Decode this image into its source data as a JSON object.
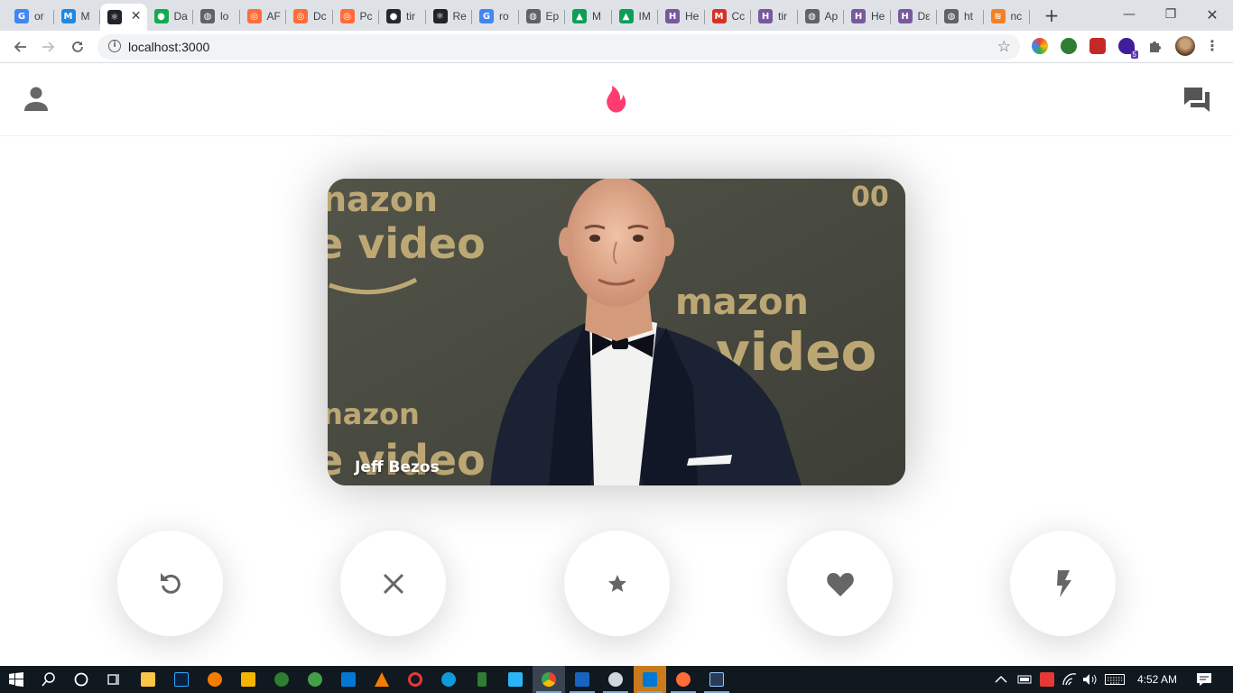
{
  "browser": {
    "tabs": [
      {
        "title": "or",
        "icon": "google-icon",
        "color": "#4285f4",
        "glyph": "G"
      },
      {
        "title": "M",
        "icon": "mui-icon",
        "color": "#1e88e5",
        "glyph": "M"
      },
      {
        "title": "",
        "icon": "react-icon",
        "color": "#20232a",
        "glyph": "⚛",
        "active": true
      },
      {
        "title": "Da",
        "icon": "mongodb-icon",
        "color": "#13aa52",
        "glyph": "●"
      },
      {
        "title": "lo",
        "icon": "globe-icon",
        "color": "#5f6368",
        "glyph": "◍"
      },
      {
        "title": "AF",
        "icon": "postman-icon",
        "color": "#ff6c37",
        "glyph": "◎"
      },
      {
        "title": "Dc",
        "icon": "postman-icon",
        "color": "#ff6c37",
        "glyph": "◎"
      },
      {
        "title": "Pc",
        "icon": "postman-icon",
        "color": "#ff6c37",
        "glyph": "◎"
      },
      {
        "title": "tir",
        "icon": "github-icon",
        "color": "#24292e",
        "glyph": "●"
      },
      {
        "title": "Re",
        "icon": "react-icon",
        "color": "#20232a",
        "glyph": "⚛"
      },
      {
        "title": "ro",
        "icon": "google-icon",
        "color": "#4285f4",
        "glyph": "G"
      },
      {
        "title": "Ep",
        "icon": "globe-icon",
        "color": "#5f6368",
        "glyph": "◍"
      },
      {
        "title": "M",
        "icon": "drive-icon",
        "color": "#0f9d58",
        "glyph": "▲"
      },
      {
        "title": "IM",
        "icon": "drive-icon",
        "color": "#0f9d58",
        "glyph": "▲"
      },
      {
        "title": "He",
        "icon": "heroku-icon",
        "color": "#79589f",
        "glyph": "H"
      },
      {
        "title": "Cc",
        "icon": "gmail-icon",
        "color": "#d93025",
        "glyph": "M"
      },
      {
        "title": "tir",
        "icon": "heroku-icon",
        "color": "#79589f",
        "glyph": "H"
      },
      {
        "title": "Ap",
        "icon": "globe-icon",
        "color": "#5f6368",
        "glyph": "◍"
      },
      {
        "title": "He",
        "icon": "heroku-icon",
        "color": "#79589f",
        "glyph": "H"
      },
      {
        "title": "Dε",
        "icon": "heroku-icon",
        "color": "#79589f",
        "glyph": "H"
      },
      {
        "title": "ht",
        "icon": "globe-icon",
        "color": "#5f6368",
        "glyph": "◍"
      },
      {
        "title": "nc",
        "icon": "stackoverflow-icon",
        "color": "#f48024",
        "glyph": "≋"
      }
    ],
    "new_tab": "+",
    "minimize": "—",
    "maximize": "❐",
    "close": "✕",
    "url": "localhost:3000",
    "extension_badge": "5"
  },
  "app": {
    "card": {
      "name": "Jeff Bezos"
    },
    "accent": "#fe3c72",
    "icon_color": "#666666",
    "buttons": [
      {
        "name": "replay-button",
        "icon": "replay-icon"
      },
      {
        "name": "close-button",
        "icon": "close-icon"
      },
      {
        "name": "star-button",
        "icon": "star-icon"
      },
      {
        "name": "favorite-button",
        "icon": "heart-icon"
      },
      {
        "name": "flash-button",
        "icon": "flash-icon"
      }
    ]
  },
  "taskbar": {
    "clock": "4:52 AM"
  }
}
